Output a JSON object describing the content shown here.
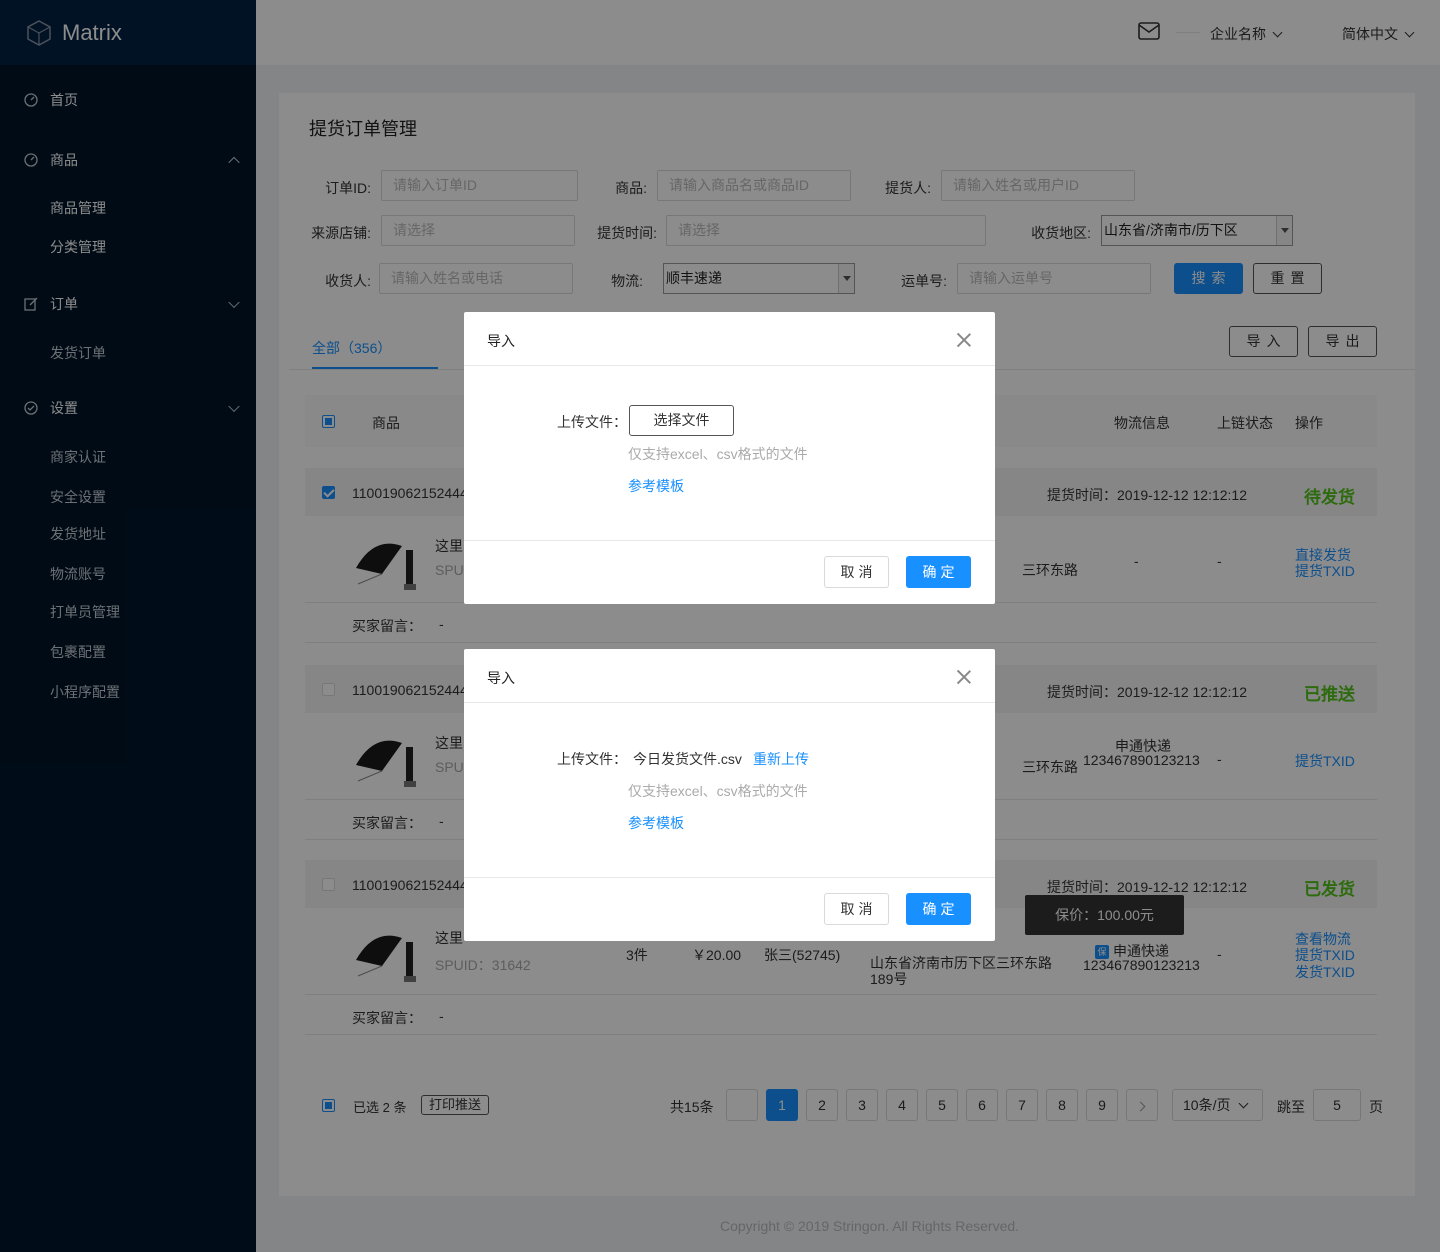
{
  "app": {
    "logo_text": "Matrix"
  },
  "header": {
    "company": "企业名称",
    "language": "简体中文"
  },
  "sidebar": {
    "home": "首页",
    "goods": "商品",
    "goods_manage": "商品管理",
    "category_manage": "分类管理",
    "orders": "订单",
    "ship_orders": "发货订单",
    "settings": "设置",
    "merchant_auth": "商家认证",
    "security": "安全设置",
    "ship_address": "发货地址",
    "logistics_account": "物流账号",
    "printer_manage": "打单员管理",
    "package_config": "包裹配置",
    "miniprogram_config": "小程序配置"
  },
  "page": {
    "title": "提货订单管理"
  },
  "filters": {
    "order_id_label": "订单ID:",
    "order_id_placeholder": "请输入订单ID",
    "goods_label": "商品:",
    "goods_placeholder": "请输入商品名或商品ID",
    "picker_label": "提货人:",
    "picker_placeholder": "请输入姓名或用户ID",
    "store_label": "来源店铺:",
    "store_placeholder": "请选择",
    "pick_time_label": "提货时间:",
    "pick_time_placeholder": "请选择",
    "region_label": "收货地区:",
    "region_value": "山东省/济南市/历下区",
    "receiver_label": "收货人:",
    "receiver_placeholder": "请输入姓名或电话",
    "logistics_label": "物流:",
    "logistics_value": "顺丰速递",
    "waybill_label": "运单号:",
    "waybill_placeholder": "请输入运单号",
    "search_btn": "搜索",
    "reset_btn": "重置"
  },
  "tabs": {
    "all": "全部（356）",
    "import_btn": "导入",
    "export_btn": "导出"
  },
  "table": {
    "col_goods": "商品",
    "col_logistics": "物流信息",
    "col_chain": "上链状态",
    "col_ops": "操作"
  },
  "orders": [
    {
      "id": "110019062152444",
      "time_label": "提货时间：2019-12-12  12:12:12",
      "status": "待发货",
      "name_prefix": "这里",
      "spu_prefix": "SPU",
      "address_tail": "三环东路",
      "logistics": "-",
      "chain": "-",
      "op1": "直接发货",
      "op2": "提货TXID",
      "memo_label": "买家留言：",
      "memo": "-"
    },
    {
      "id": "110019062152444",
      "time_label": "提货时间：2019-12-12  12:12:12",
      "status": "已推送",
      "name_prefix": "这里",
      "spu_prefix": "SPU",
      "address_tail": "三环东路",
      "logistics_name": "申通快递",
      "logistics_no": "123467890123213",
      "chain": "-",
      "op1": "提货TXID",
      "memo_label": "买家留言：",
      "memo": "-"
    },
    {
      "id": "110019062152444",
      "time_label": "提货时间：2019-12-12  12:12:12",
      "status": "已发货",
      "name_prefix": "这里",
      "spu": "SPUID：31642",
      "qty": "3件",
      "price": "￥20.00",
      "receiver": "张三(52745)",
      "address": "山东省济南市历下区三环东路",
      "address2": "189号",
      "logistics_name": "申通快递",
      "logistics_no": "123467890123213",
      "chain": "-",
      "op1": "查看物流",
      "op2": "提货TXID",
      "op3": "发货TXID",
      "memo_label": "买家留言：",
      "memo": "-",
      "tooltip": "保价：100.00元",
      "bao": "保"
    }
  ],
  "bulk": {
    "selected": "已选 2 条",
    "print_push": "打印推送"
  },
  "pagination": {
    "total": "共15条",
    "pages": [
      "1",
      "2",
      "3",
      "4",
      "5",
      "6",
      "7",
      "8",
      "9"
    ],
    "page_size": "10条/页",
    "jump_label": "跳至",
    "jump_value": "5",
    "page_unit": "页"
  },
  "footer": {
    "copyright": "Copyright © 2019 Stringon. All Rights Reserved."
  },
  "modal1": {
    "title": "导入",
    "upload_label": "上传文件：",
    "choose_file": "选择文件",
    "hint": "仅支持excel、csv格式的文件",
    "template": "参考模板",
    "cancel": "取消",
    "ok": "确定"
  },
  "modal2": {
    "title": "导入",
    "upload_label": "上传文件：",
    "file_name": "今日发货文件.csv",
    "reupload": "重新上传",
    "hint": "仅支持excel、csv格式的文件",
    "template": "参考模板",
    "cancel": "取消",
    "ok": "确定"
  }
}
